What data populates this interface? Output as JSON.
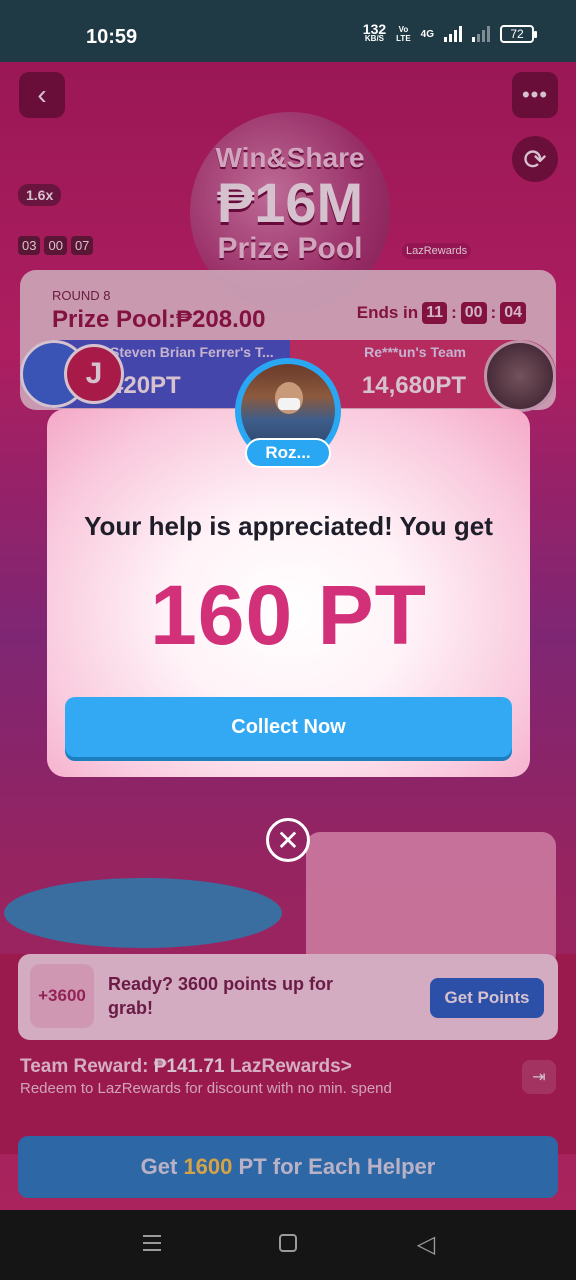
{
  "status_bar": {
    "time": "10:59",
    "speed_value": "132",
    "speed_unit": "KB/S",
    "volte_top": "Vo",
    "volte_bottom": "LTE",
    "network": "4G",
    "battery": "72"
  },
  "header": {
    "title_line1": "Win&Share",
    "title_line2": "₱16M",
    "title_line3": "Prize Pool",
    "brand_tag": "LazRewards",
    "multiplier": "1.6x",
    "timer": [
      "03",
      "00",
      "07"
    ]
  },
  "round": {
    "label": "ROUND 8",
    "prize_pool": "Prize Pool:₱208.00",
    "ends_label": "Ends in",
    "ends_hours": "11",
    "ends_minutes": "00",
    "ends_seconds": "04"
  },
  "teams": {
    "left_name": "Steven Brian Ferrer's T...",
    "left_points": "420PT",
    "left_initial": "J",
    "right_name": "Re***un's Team",
    "right_points": "14,680PT"
  },
  "modal": {
    "helper_name": "Roz...",
    "message": "Your help is appreciated! You get",
    "points": "160 PT",
    "collect_button": "Collect Now"
  },
  "offer": {
    "badge": "+3600",
    "text": "Ready? 3600 points up for grab!",
    "button": "Get Points"
  },
  "team_reward": {
    "label": "Team Reward:",
    "amount": "₱141.71",
    "link": "LazRewards>",
    "note": "Redeem to LazRewards for discount with no min. spend"
  },
  "cta": {
    "prefix": "Get",
    "highlight": "1600",
    "suffix": "PT for Each Helper"
  },
  "colors": {
    "accent_pink": "#d3307a",
    "button_blue": "#33a9f3",
    "highlight_yellow": "#ffd54a"
  },
  "icons": {
    "back": "chevron-left-icon",
    "more": "more-dots-icon",
    "refresh": "refresh-icon",
    "close": "close-icon",
    "exit": "exit-icon"
  }
}
